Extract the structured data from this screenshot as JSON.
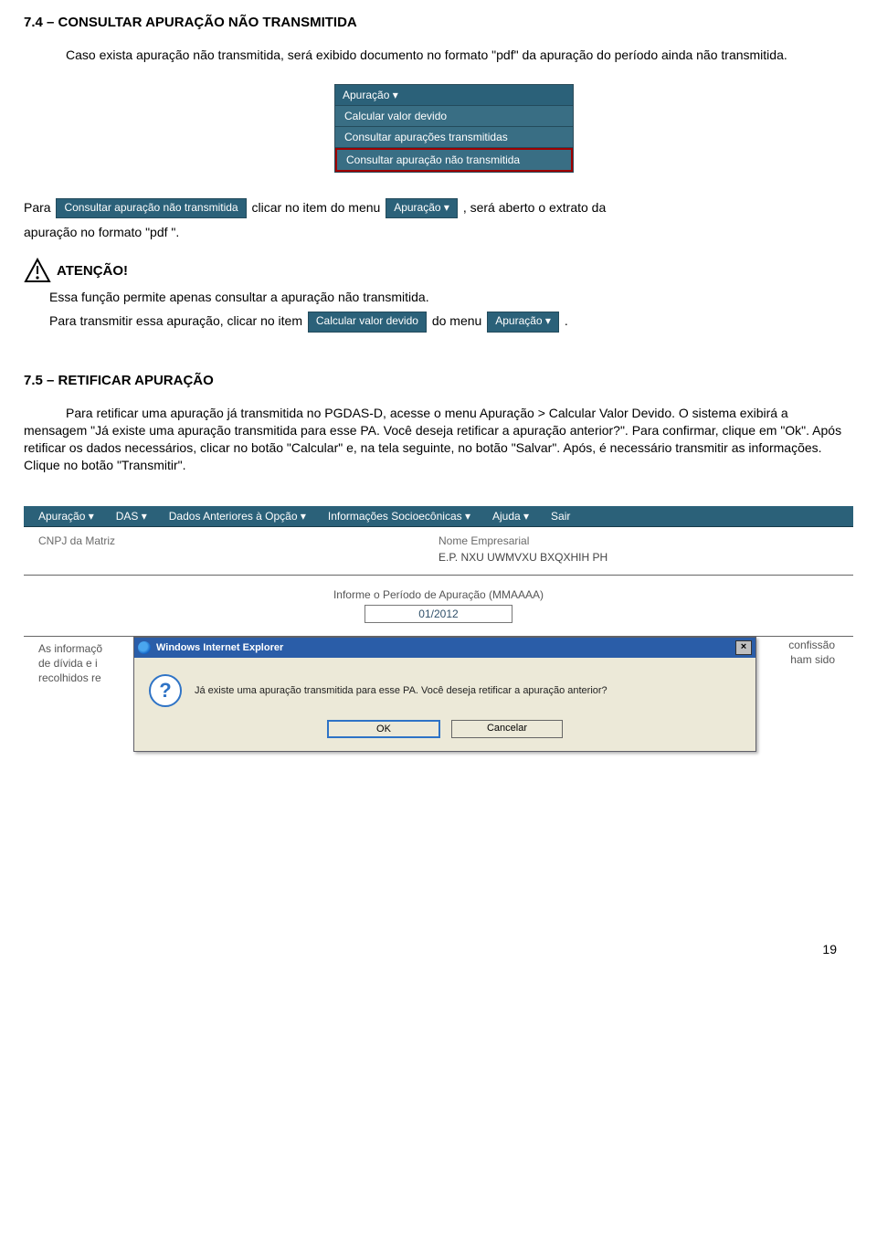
{
  "section74": {
    "title": "7.4 – CONSULTAR APURAÇÃO NÃO TRANSMITIDA",
    "intro": "Caso exista apuração não transmitida, será exibido documento no formato \"pdf\" da apuração do período ainda não transmitida.",
    "menu_header": "Apuração ▾",
    "menu_item1": "Calcular valor devido",
    "menu_item2": "Consultar apurações transmitidas",
    "menu_item3": "Consultar apuração não transmitida",
    "para_pt1": "Para",
    "chip_consultar": "Consultar apuração não transmitida",
    "para_pt2": "clicar no item do menu",
    "chip_apuracao": "Apuração ▾",
    "para_pt3": ", será aberto o extrato da",
    "para_line2": "apuração no formato \"pdf \".",
    "atencao": "ATENÇÃO!",
    "warn_line1": "Essa função permite apenas consultar a apuração não transmitida.",
    "warn_line2a": "Para transmitir essa apuração, clicar no item",
    "chip_calc": "Calcular valor devido",
    "warn_line2b": "do menu",
    "chip_apuracao2": "Apuração ▾",
    "period": "."
  },
  "section75": {
    "title": "7.5 – RETIFICAR APURAÇÃO",
    "body": "Para retificar uma apuração já transmitida no PGDAS-D, acesse o menu Apuração > Calcular Valor Devido. O sistema exibirá a mensagem \"Já existe uma apuração transmitida para esse PA. Você deseja retificar a apuração anterior?\". Para confirmar, clique em \"Ok\". Após retificar os dados necessários, clicar no botão \"Calcular\" e, na tela seguinte, no botão \"Salvar\". Após, é necessário transmitir as informações. Clique no botão \"Transmitir\"."
  },
  "app": {
    "nav": {
      "apuracao": "Apuração ▾",
      "das": "DAS ▾",
      "anteriores": "Dados Anteriores à Opção ▾",
      "socio": "Informações Socioecônicas ▾",
      "ajuda": "Ajuda ▾",
      "sair": "Sair"
    },
    "form": {
      "cnpj_label": "CNPJ da Matriz",
      "nome_label": "Nome Empresarial",
      "nome_value": "E.P. NXU UWMVXU BXQXHIH PH",
      "periodo_label": "Informe o Período de Apuração (MMAAAA)",
      "periodo_value": "01/2012"
    },
    "bgtext_left": "As informaçõ\nde dívida e i\nrecolhidos re",
    "bgtext_right": "confissão\nham sido",
    "dialog": {
      "title": "Windows Internet Explorer",
      "message": "Já existe uma apuração transmitida para esse PA. Você deseja retificar a apuração anterior?",
      "ok": "OK",
      "cancel": "Cancelar"
    }
  },
  "page_number": "19"
}
